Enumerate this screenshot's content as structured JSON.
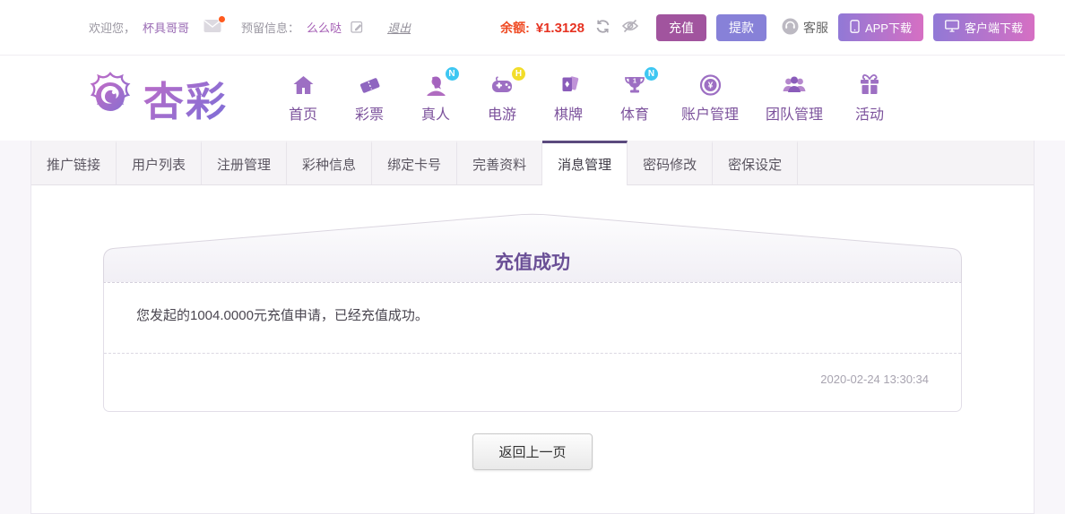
{
  "topbar": {
    "welcome_label": "欢迎您，",
    "username": "杯具哥哥",
    "message_icon": "envelope-icon",
    "unread_dot_color": "#ff5a1e",
    "reserved_label": "预留信息：",
    "reserved_value": "么么哒",
    "edit_icon": "edit-icon",
    "logout_label": "退出",
    "balance_label": "余额:",
    "balance_value": "¥1.3128",
    "balance_color": "#ef4a23",
    "refresh_icon": "refresh-icon",
    "hide_balance_icon": "eye-slash-icon",
    "recharge_button": "充值",
    "recharge_color": "#a1549e",
    "withdraw_button": "提款",
    "withdraw_color": "#8781d8",
    "service_icon": "customer-service-icon",
    "service_label": "客服",
    "app_download_button": "APP下载",
    "client_download_button": "客户端下载",
    "download_gradient": [
      "#9179d6",
      "#d66fc3"
    ]
  },
  "header": {
    "brand_name": "杏彩",
    "brand_logo_icon": "flower-logo-icon",
    "nav_items": [
      {
        "label": "首页",
        "icon": "home-icon",
        "badge": ""
      },
      {
        "label": "彩票",
        "icon": "ticket-icon",
        "badge": ""
      },
      {
        "label": "真人",
        "icon": "person-icon",
        "badge": "N"
      },
      {
        "label": "电游",
        "icon": "gamepad-icon",
        "badge": "H"
      },
      {
        "label": "棋牌",
        "icon": "cards-icon",
        "badge": ""
      },
      {
        "label": "体育",
        "icon": "trophy-icon",
        "badge": "N"
      },
      {
        "label": "账户管理",
        "icon": "coin-icon",
        "badge": ""
      },
      {
        "label": "团队管理",
        "icon": "team-icon",
        "badge": ""
      },
      {
        "label": "活动",
        "icon": "gift-icon",
        "badge": ""
      }
    ],
    "badge_colors": {
      "N": "#3ec7f2",
      "H": "#f2dd2a"
    }
  },
  "tabs": {
    "active": "消息管理",
    "active_border_color": "#5b4a7e",
    "items": [
      {
        "label": "推广链接"
      },
      {
        "label": "用户列表"
      },
      {
        "label": "注册管理"
      },
      {
        "label": "彩种信息"
      },
      {
        "label": "绑定卡号"
      },
      {
        "label": "完善资料"
      },
      {
        "label": "消息管理"
      },
      {
        "label": "密码修改"
      },
      {
        "label": "密保设定"
      }
    ]
  },
  "message": {
    "title": "充值成功",
    "title_color": "#6a4f96",
    "body": "您发起的1004.0000元充值申请，已经充值成功。",
    "timestamp": "2020-02-24 13:30:34",
    "back_button": "返回上一页"
  }
}
